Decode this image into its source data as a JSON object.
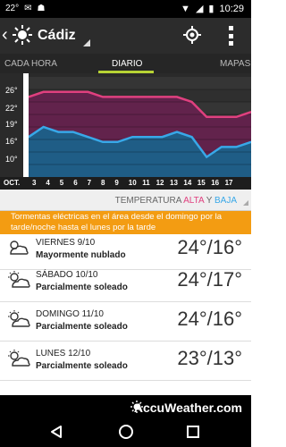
{
  "status_bar": {
    "temp": "22°",
    "time": "10:29"
  },
  "app_bar": {
    "city": "Cádiz",
    "icons": [
      "back-icon",
      "sun-icon",
      "locate-icon",
      "menu-icon"
    ]
  },
  "tabs": [
    {
      "label": "CADA HORA"
    },
    {
      "label": "DIARIO"
    },
    {
      "label": "MAPAS"
    }
  ],
  "legend": {
    "prefix": "TEMPERATURA",
    "alta": "ALTA",
    "y": "Y",
    "baja": "BAJA"
  },
  "alert": {
    "text": "Tormentas eléctricas en el área desde el domingo por la tarde/noche hasta el lunes por la tarde"
  },
  "days": [
    {
      "name": "VIERNES 9/10",
      "desc": "Mayormente nublado",
      "temp": "24°/16°"
    },
    {
      "name": "SÁBADO 10/10",
      "desc": "Parcialmente soleado",
      "temp": "24°/17°"
    },
    {
      "name": "DOMINGO 11/10",
      "desc": "Parcialmente soleado",
      "temp": "24°/16°"
    },
    {
      "name": "LUNES 12/10",
      "desc": "Parcialmente soleado",
      "temp": "23°/13°"
    }
  ],
  "brand": {
    "name": "AccuWeather.com"
  },
  "chart_data": {
    "type": "area",
    "categories": [
      "OCT.",
      "3",
      "4",
      "5",
      "6",
      "7",
      "8",
      "9",
      "10",
      "11",
      "12",
      "13",
      "14",
      "15",
      "16",
      "17"
    ],
    "y_ticks": [
      "26°",
      "22°",
      "19°",
      "16°",
      "10°"
    ],
    "series": [
      {
        "name": "ALTA",
        "values": [
          24,
          25,
          25,
          25,
          25,
          24,
          24,
          24,
          24,
          24,
          24,
          23,
          20,
          20,
          20,
          21
        ]
      },
      {
        "name": "BAJA",
        "values": [
          16,
          18,
          17,
          17,
          16,
          15,
          15,
          16,
          16,
          16,
          17,
          16,
          12,
          14,
          14,
          15
        ]
      }
    ],
    "colors": {
      "alta": "#e0407f",
      "baja": "#38a8e8",
      "alta_fill": "#6a2050",
      "baja_fill": "#1f5d86"
    },
    "ylim": [
      8,
      28
    ],
    "grid": true
  }
}
